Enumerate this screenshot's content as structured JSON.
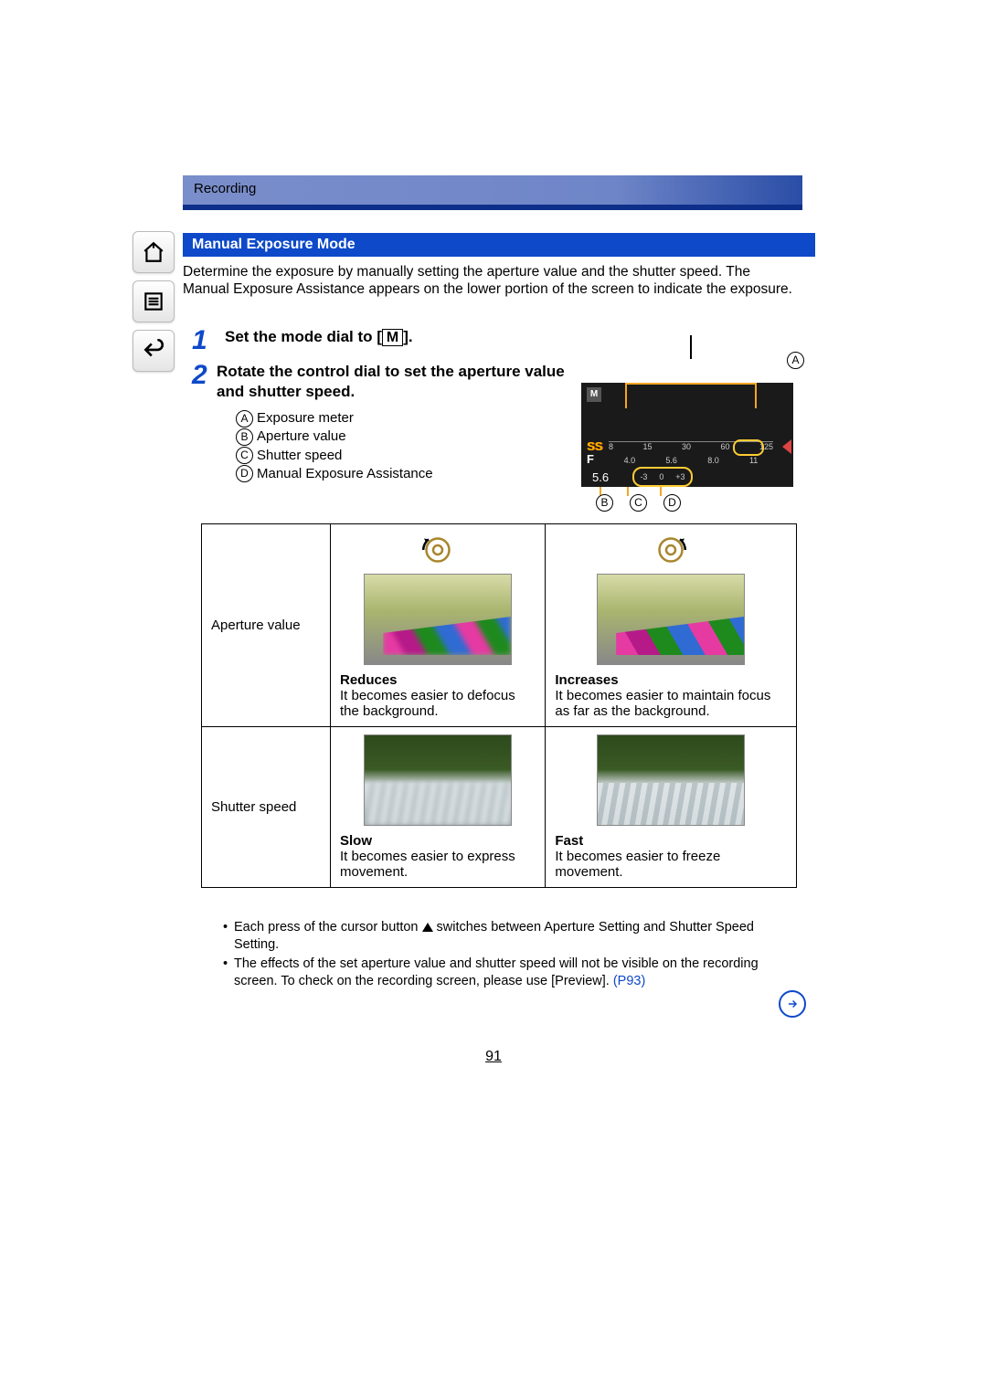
{
  "breadcrumb": "Recording",
  "heading": "Manual Exposure Mode",
  "intro": "Determine the exposure by manually setting the aperture value and the shutter speed. The Manual Exposure Assistance appears on the lower portion of the screen to indicate the exposure.",
  "steps": {
    "s1_num": "1",
    "s1_pre": "Set the mode dial to [",
    "s1_m": "M",
    "s1_post": "].",
    "s2_num": "2",
    "s2_text": "Rotate the control dial to set the aperture value and shutter speed."
  },
  "legend": {
    "a": "Exposure meter",
    "b": "Aperture value",
    "c": "Shutter speed",
    "d": "Manual Exposure Assistance"
  },
  "diagram": {
    "anno_a": "A",
    "anno_b": "B",
    "anno_c": "C",
    "anno_d": "D",
    "m": "M",
    "ss": "SS",
    "f": "F",
    "ss_ticks": [
      "8",
      "15",
      "30",
      "60",
      "125"
    ],
    "f_ticks": [
      "4.0",
      "5.6",
      "8.0",
      "11"
    ],
    "val": "5.6",
    "ev": [
      "-3",
      "0",
      "+3"
    ]
  },
  "table": {
    "row1_label": "Aperture value",
    "row1_col1_heading": "Reduces",
    "row1_col1_text": "It becomes easier to defocus the background.",
    "row1_col2_heading": "Increases",
    "row1_col2_text": "It becomes easier to maintain focus as far as the background.",
    "row2_label": "Shutter speed",
    "row2_col1_heading": "Slow",
    "row2_col1_text": "It becomes easier to express movement.",
    "row2_col2_heading": "Fast",
    "row2_col2_text": "It becomes easier to freeze movement."
  },
  "bullets": {
    "b1": "Each press of the cursor button ▲ switches between Aperture Setting and Shutter Speed Setting.",
    "b2a": "The effects of the set aperture value and shutter speed will not be visible on the recording screen. To check on the recording screen, please use [Preview]. ",
    "b2link": "(P93)"
  },
  "page_number": "91"
}
